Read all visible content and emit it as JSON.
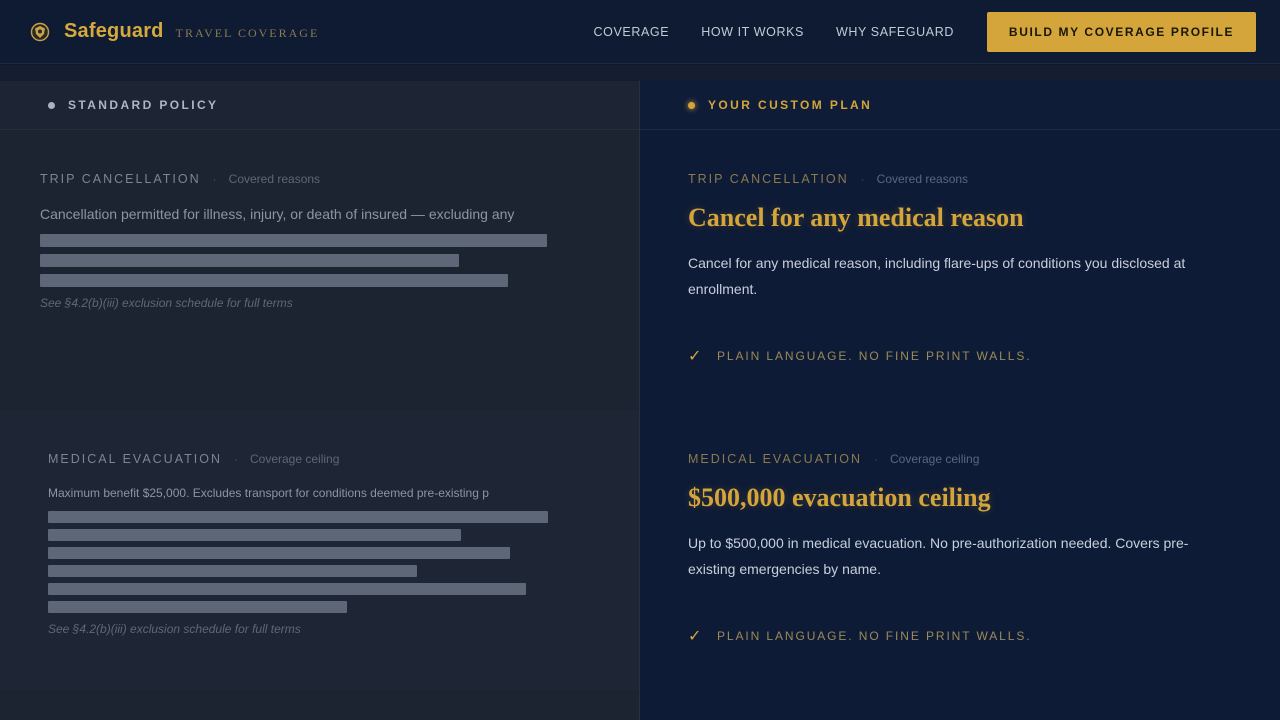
{
  "header": {
    "brand": "Safeguard",
    "tagline": "TRAVEL COVERAGE",
    "nav": [
      "COVERAGE",
      "HOW IT WORKS",
      "WHY SAFEGUARD"
    ],
    "cta": "BUILD MY COVERAGE PROFILE"
  },
  "standard": {
    "title": "STANDARD POLICY",
    "sections": [
      {
        "label": "TRIP CANCELLATION",
        "sub": "Covered reasons",
        "text": "Cancellation permitted for illness, injury, or death of insured — excluding any",
        "redacted_lines": 3,
        "fine": "See §4.2(b)(iii) exclusion schedule for full terms"
      },
      {
        "label": "MEDICAL EVACUATION",
        "sub": "Coverage ceiling",
        "text": "Maximum benefit $25,000. Excludes transport for conditions deemed pre-existing p",
        "redacted_lines": 6,
        "fine": "See §4.2(b)(iii) exclusion schedule for full terms"
      }
    ]
  },
  "custom": {
    "title": "YOUR CUSTOM PLAN",
    "sections": [
      {
        "label": "TRIP CANCELLATION",
        "sub": "Covered reasons",
        "headline": "Cancel for any medical reason",
        "body": "Cancel for any medical reason, including flare-ups of conditions you disclosed at enrollment.",
        "check": "PLAIN LANGUAGE. NO FINE PRINT WALLS."
      },
      {
        "label": "MEDICAL EVACUATION",
        "sub": "Coverage ceiling",
        "headline": "$500,000 evacuation ceiling",
        "body": "Up to $500,000 in medical evacuation. No pre-authorization needed. Covers pre-existing emergencies by name.",
        "check": "PLAIN LANGUAGE. NO FINE PRINT WALLS."
      }
    ]
  },
  "colors": {
    "accent": "#d4a53a",
    "navy": "#0e1b36",
    "slate": "#1c2331"
  }
}
